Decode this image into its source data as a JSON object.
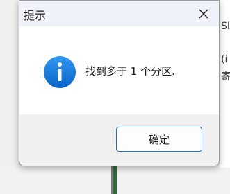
{
  "background": {
    "text_fragments": [
      "SI",
      "(i",
      "寄"
    ]
  },
  "dialog": {
    "title": "提示",
    "message": "找到多于 1 个分区.",
    "ok_label": "确定",
    "icon": "info-icon",
    "close_icon": "close-icon"
  },
  "colors": {
    "title_bar": "#eff3f9",
    "content_bg": "#ffffff",
    "footer_bg": "#f0f0f0",
    "info_icon": "#1479d8",
    "button_border": "#1e6fc9"
  }
}
